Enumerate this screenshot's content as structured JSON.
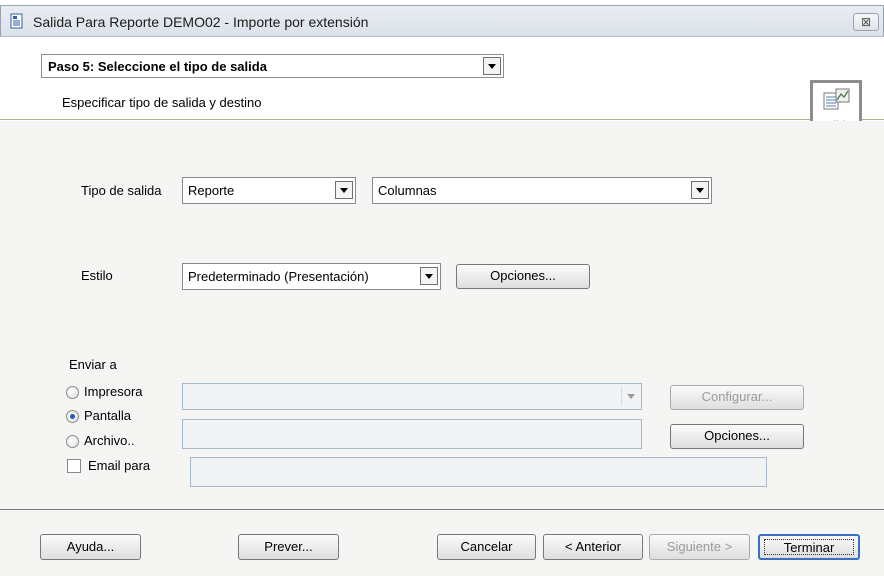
{
  "window": {
    "title": "Salida Para Reporte DEMO02 - Importe por extensión",
    "close_glyph": "⊠"
  },
  "header": {
    "step_value": "Paso 5: Seleccione el tipo de salida",
    "step_description": "Especificar tipo de salida y destino",
    "output_icon_label": "salida"
  },
  "form": {
    "output_type_label": "Tipo de salida",
    "output_type_value": "Reporte",
    "columns_value": "Columnas",
    "style_label": "Estilo",
    "style_value": "Predeterminado (Presentación)",
    "style_options_button": "Opciones..."
  },
  "send_to": {
    "label": "Enviar a",
    "printer_label": "Impresora",
    "screen_label": "Pantalla",
    "file_label": "Archivo..",
    "email_label": "Email para",
    "selected": "Pantalla",
    "email_checked": false,
    "printer_value": "",
    "file_value": "",
    "email_value": "",
    "configure_button": "Configurar...",
    "options_button": "Opciones..."
  },
  "footer": {
    "help_button": "Ayuda...",
    "preview_button": "Prever...",
    "cancel_button": "Cancelar",
    "previous_button": "< Anterior",
    "next_button": "Siguiente >",
    "finish_button": "Terminar"
  },
  "colors": {
    "panel_bg": "#f5f5f4",
    "header_rule": "#b3b48a",
    "radio_selected": "#2a58b8"
  }
}
